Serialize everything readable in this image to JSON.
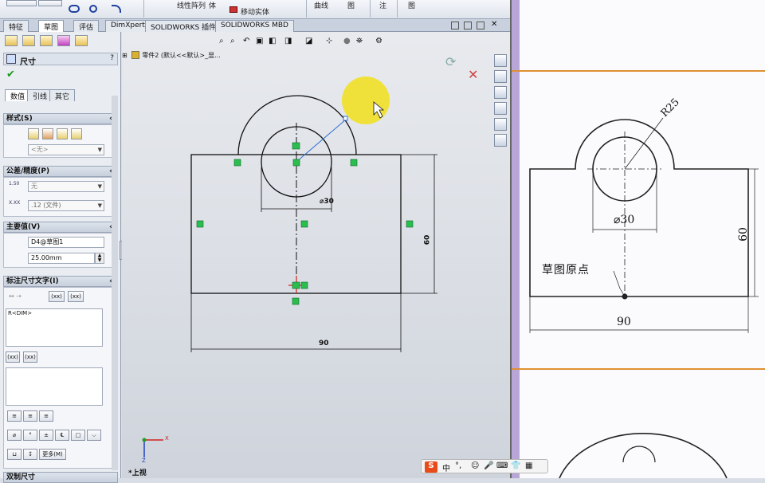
{
  "ribbon": {
    "items": [
      "图",
      "节",
      "线性阵列",
      "体",
      "移动实体",
      "曲线",
      "图",
      "注",
      "图"
    ],
    "move_label": "移动实体"
  },
  "command_tabs": [
    "特征",
    "草图",
    "评估",
    "DimXpert",
    "SOLIDWORKS 插件",
    "SOLIDWORKS MBD"
  ],
  "active_tab": "草图",
  "property_manager": {
    "title": "尺寸",
    "tabs": [
      "数值",
      "引线",
      "其它"
    ],
    "style": {
      "header": "样式(S)",
      "value": "<无>"
    },
    "tolerance": {
      "header": "公差/精度(P)",
      "type": "无",
      "precision": ".12 (文件)"
    },
    "primary_value": {
      "header": "主要值(V)",
      "name": "D4@草图1",
      "value": "25.00mm"
    },
    "dim_text": {
      "header": "标注尺寸文字(I)",
      "text": "R<DIM>",
      "btn1": "(xx)",
      "btn2": "(xx)",
      "btn3": "(xx)",
      "btn4": "(xx)",
      "more": "更多(M)"
    },
    "bottom_item": "双制尺寸"
  },
  "feature_tree": {
    "label": "零件2 (默认<<默认>_显..."
  },
  "sketch": {
    "dims": {
      "diameter": "⌀30",
      "height": "60",
      "width": "90"
    },
    "view_label": "*上视",
    "axis": {
      "x": "X",
      "y": "Y",
      "z": "Z"
    }
  },
  "book": {
    "radius_label": "R25",
    "diameter_label": "⌀30",
    "height_label": "60",
    "width_label": "90",
    "origin_label": "草图原点"
  },
  "ime": {
    "logo": "S",
    "lang": "中",
    "punct": "°,"
  },
  "colors": {
    "accent": "#f0e030",
    "sketch_green": "#2bbd4e",
    "line": "#111111"
  }
}
